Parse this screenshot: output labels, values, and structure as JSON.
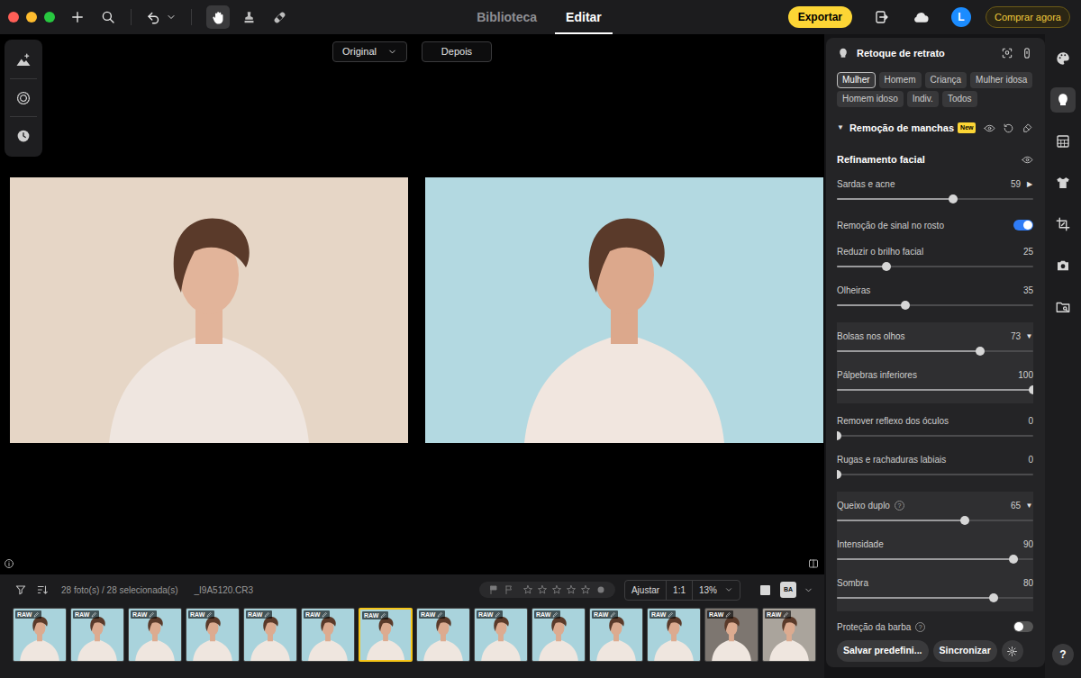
{
  "tools": [
    {
      "kind": "hand",
      "selected": true
    },
    {
      "kind": "clone",
      "selected": false
    },
    {
      "kind": "heal",
      "selected": false
    }
  ],
  "nav_tabs": [
    {
      "label": "Biblioteca",
      "selected": false
    },
    {
      "label": "Editar",
      "selected": true
    }
  ],
  "export_button": "Exportar",
  "account": {
    "avatar": "L"
  },
  "buy_button": "Comprar agora",
  "side_tools": [
    {
      "kind": "enhance"
    },
    {
      "kind": "noise"
    },
    {
      "kind": "history"
    }
  ],
  "compare_view": {
    "before": "Original",
    "after": "Depois"
  },
  "panel": {
    "title": "Retoque de retrato",
    "presets": [
      {
        "label": "Mulher",
        "selected": true
      },
      {
        "label": "Homem",
        "selected": false
      },
      {
        "label": "Criança",
        "selected": false
      },
      {
        "label": "Mulher idosa",
        "selected": false
      },
      {
        "label": "Homem idoso",
        "selected": false
      },
      {
        "label": "Indiv.",
        "selected": false
      },
      {
        "label": "Todos",
        "selected": false
      }
    ],
    "section": {
      "arrow": "▼",
      "title": "Remoção de manchas",
      "badge": "New"
    },
    "subsection": "Refinamento facial",
    "groups": [
      {
        "highlighted": false,
        "items": [
          {
            "kind": "slider",
            "label": "Sardas e acne",
            "value": "59",
            "arrow": "▶",
            "level": 0.59
          },
          {
            "kind": "toggle",
            "label": "Remoção de sinal no rosto",
            "on": true
          },
          {
            "kind": "slider",
            "label": "Reduzir o brilho facial",
            "value": "25",
            "level": 0.25
          },
          {
            "kind": "slider",
            "label": "Olheiras",
            "value": "35",
            "level": 0.35
          }
        ]
      },
      {
        "highlighted": true,
        "items": [
          {
            "kind": "slider",
            "label": "Bolsas nos olhos",
            "value": "73",
            "arrow": "▼",
            "level": 0.73
          },
          {
            "kind": "slider",
            "label": "Pálpebras inferiores",
            "value": "100",
            "level": 1.0
          }
        ]
      },
      {
        "highlighted": false,
        "items": [
          {
            "kind": "slider",
            "label": "Remover reflexo dos óculos",
            "value": "0",
            "level": 0.0
          },
          {
            "kind": "slider",
            "label": "Rugas e rachaduras labiais",
            "value": "0",
            "level": 0.0
          }
        ]
      },
      {
        "highlighted": true,
        "items": [
          {
            "kind": "slider",
            "label": "Queixo duplo",
            "help": "?",
            "value": "65",
            "arrow": "▼",
            "level": 0.65
          },
          {
            "kind": "slider",
            "label": "Intensidade",
            "value": "90",
            "level": 0.9
          },
          {
            "kind": "slider",
            "label": "Sombra",
            "value": "80",
            "level": 0.8
          }
        ]
      },
      {
        "highlighted": false,
        "items": [
          {
            "kind": "toggle",
            "label": "Proteção da barba",
            "help": "?",
            "on": false
          }
        ]
      }
    ],
    "footer": {
      "save": "Salvar predefini...",
      "sync": "Sincronizar"
    }
  },
  "rail": [
    {
      "kind": "palette",
      "selected": false
    },
    {
      "kind": "face",
      "selected": true
    },
    {
      "kind": "texture",
      "selected": false
    },
    {
      "kind": "shirt",
      "selected": false
    },
    {
      "kind": "crop",
      "selected": false
    },
    {
      "kind": "camera",
      "selected": false
    },
    {
      "kind": "folder",
      "selected": false
    }
  ],
  "help_button": "?",
  "filmstrip": {
    "count": "28 foto(s) / 28 selecionada(s)",
    "filename": "_I9A5120.CR3",
    "stars": 0,
    "fit": "Ajustar",
    "actual": "1:1",
    "zoom": "13%",
    "view_modes": [
      {
        "kind": "single",
        "selected": false
      },
      {
        "kind": "compare",
        "label": "BA",
        "selected": true
      }
    ],
    "thumbnails": [
      {
        "badge": "RAW",
        "edited": true,
        "selected": false,
        "color": "#a9d3dc"
      },
      {
        "badge": "RAW",
        "edited": true,
        "selected": false,
        "color": "#a9d3dc"
      },
      {
        "badge": "RAW",
        "edited": true,
        "selected": false,
        "color": "#a9d3dc"
      },
      {
        "badge": "RAW",
        "edited": true,
        "selected": false,
        "color": "#a9d3dc"
      },
      {
        "badge": "RAW",
        "edited": true,
        "selected": false,
        "color": "#a9d3dc"
      },
      {
        "badge": "RAW",
        "edited": true,
        "selected": false,
        "color": "#a9d3dc"
      },
      {
        "badge": "RAW",
        "edited": true,
        "selected": true,
        "color": "#a9d3dc"
      },
      {
        "badge": "RAW",
        "edited": true,
        "selected": false,
        "color": "#a9d3dc"
      },
      {
        "badge": "RAW",
        "edited": true,
        "selected": false,
        "color": "#a9d3dc"
      },
      {
        "badge": "RAW",
        "edited": true,
        "selected": false,
        "color": "#a9d3dc"
      },
      {
        "badge": "RAW",
        "edited": true,
        "selected": false,
        "color": "#a9d3dc"
      },
      {
        "badge": "RAW",
        "edited": true,
        "selected": false,
        "color": "#a9d3dc"
      },
      {
        "badge": "RAW",
        "edited": true,
        "selected": false,
        "color": "#7d7670"
      },
      {
        "badge": "RAW",
        "edited": true,
        "selected": false,
        "color": "#aaa49c"
      }
    ]
  }
}
